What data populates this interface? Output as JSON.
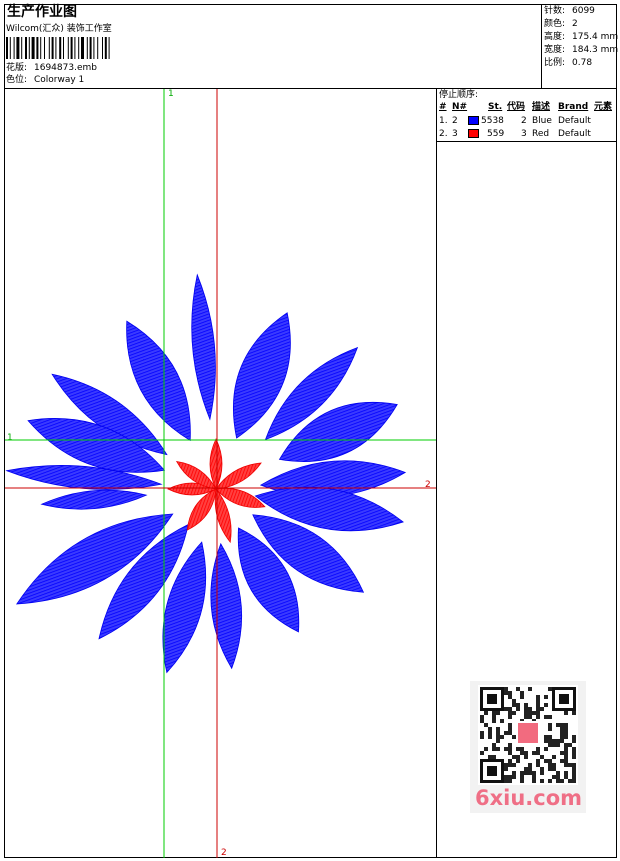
{
  "header": {
    "title": "生产作业图",
    "company": "Wilcom(汇众) 装饰工作室",
    "design_file_label": "花版:",
    "design_file": "1694873.emb",
    "colorway_label": "色位:",
    "colorway": "Colorway 1"
  },
  "stats": {
    "stitches_label": "针数:",
    "stitches": "6099",
    "colors_label": "颜色:",
    "colors": "2",
    "height_label": "高度:",
    "height": "175.4 mm",
    "width_label": "宽度:",
    "width": "184.3 mm",
    "scale_label": "比例:",
    "scale": "0.78"
  },
  "stop_sequence": {
    "title": "停止顺序:",
    "columns": [
      "#",
      "N#",
      "St.",
      "代码",
      "描述",
      "Brand",
      "元素"
    ],
    "rows": [
      {
        "num": "1.",
        "n": "2",
        "color": "#0000ff",
        "stitches": "5538",
        "code": "2",
        "desc": "Blue",
        "brand": "Default"
      },
      {
        "num": "2.",
        "n": "3",
        "color": "#ff0000",
        "stitches": "559",
        "code": "3",
        "desc": "Red",
        "brand": "Default"
      }
    ]
  },
  "axes": {
    "green_top": "1",
    "green_left": "1",
    "red_right": "2",
    "red_bottom": "2"
  },
  "colors": {
    "thread_blue": "#0000ff",
    "thread_red": "#ff0000",
    "axis_green": "#00cc00",
    "axis_red": "#cc0000",
    "brand_pink": "#ef6f86"
  },
  "watermark": {
    "text": "6xiu.com",
    "icon": "qr-code-icon"
  }
}
